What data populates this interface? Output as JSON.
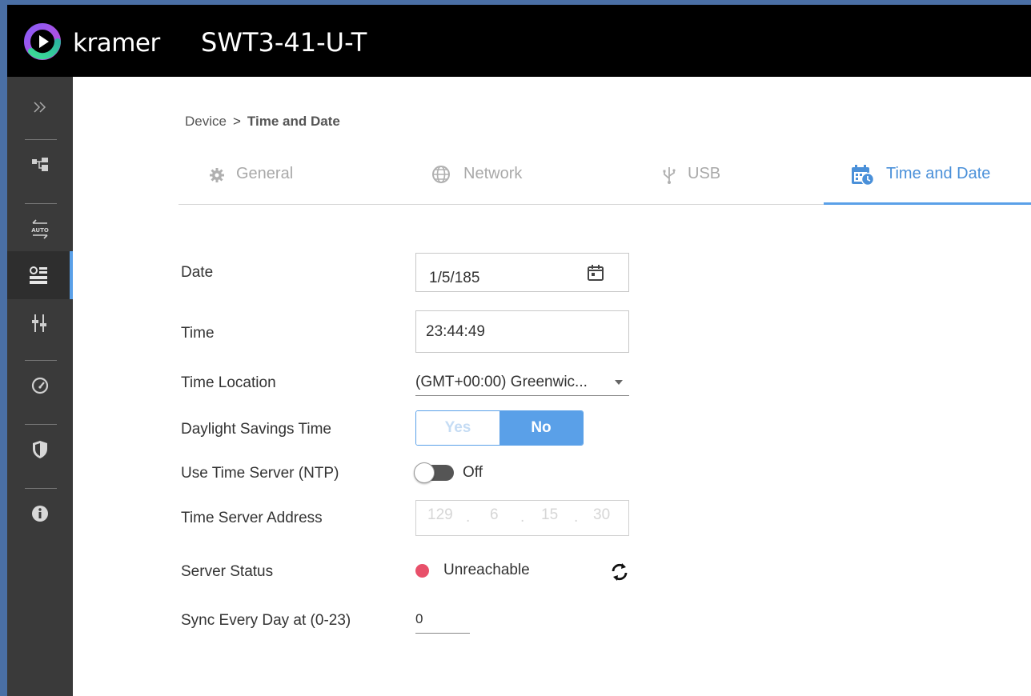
{
  "header": {
    "brand": "kramer",
    "device_name": "SWT3-41-U-T"
  },
  "sidebar": {
    "items": [
      {
        "icon": "double-chevron-right-icon"
      },
      {
        "icon": "routing-icon"
      },
      {
        "icon": "auto-switch-icon"
      },
      {
        "icon": "device-settings-icon",
        "active": true
      },
      {
        "icon": "audio-mixer-icon"
      },
      {
        "icon": "diagnostics-gauge-icon"
      },
      {
        "icon": "security-shield-icon"
      },
      {
        "icon": "info-icon"
      }
    ]
  },
  "breadcrumb": {
    "parent": "Device",
    "separator": ">",
    "current": "Time and Date"
  },
  "tabs": [
    {
      "label": "General",
      "icon": "gear-icon"
    },
    {
      "label": "Network",
      "icon": "globe-icon"
    },
    {
      "label": "USB",
      "icon": "usb-icon"
    },
    {
      "label": "Time and Date",
      "icon": "calendar-clock-icon",
      "active": true
    }
  ],
  "form": {
    "date": {
      "label": "Date",
      "value": "1/5/185"
    },
    "time": {
      "label": "Time",
      "value": "23:44:49"
    },
    "time_location": {
      "label": "Time Location",
      "value": "(GMT+00:00) Greenwic..."
    },
    "dst": {
      "label": "Daylight Savings Time",
      "yes": "Yes",
      "no": "No",
      "selected": "No"
    },
    "ntp": {
      "label": "Use Time Server (NTP)",
      "state": "Off"
    },
    "server_address": {
      "label": "Time Server Address",
      "octets": [
        "129",
        "6",
        "15",
        "30"
      ]
    },
    "server_status": {
      "label": "Server Status",
      "value": "Unreachable",
      "color": "#e8506a"
    },
    "sync": {
      "label": "Sync Every Day at (0-23)",
      "value": "0"
    }
  },
  "colors": {
    "accent": "#5aa0e8",
    "header_bg": "#000000",
    "sidebar_bg": "#3a3a3a"
  }
}
